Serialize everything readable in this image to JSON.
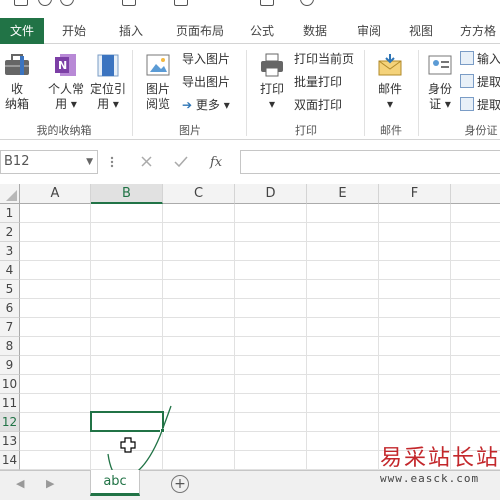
{
  "tabs": [
    "文件",
    "开始",
    "插入",
    "页面布局",
    "公式",
    "数据",
    "审阅",
    "视图",
    "方方格"
  ],
  "ribbon": {
    "shoujian": {
      "line1": "收",
      "line2": "纳箱"
    },
    "personal": {
      "line1": "个人常",
      "line2": "用 ▾"
    },
    "locate": {
      "line1": "定位引",
      "line2": "用 ▾"
    },
    "group1_label": "我的收纳箱",
    "img_browse": {
      "line1": "图片",
      "line2": "阅览"
    },
    "import_img": "导入图片",
    "export_img": "导出图片",
    "more": "更多 ▾",
    "group2_label": "图片",
    "print": {
      "line1": "打印",
      "line2": "▾"
    },
    "print_current": "打印当前页",
    "batch_print": "批量打印",
    "duplex_print": "双面打印",
    "group3_label": "打印",
    "mail": {
      "line1": "邮件",
      "line2": "▾"
    },
    "group4_label": "邮件",
    "idcard": {
      "line1": "身份",
      "line2": "证 ▾"
    },
    "input_id": "输入身",
    "extract_gender": "提取性",
    "extract_birth": "提取出",
    "group5_label": "身份证"
  },
  "formula_bar": {
    "name_box": "B12",
    "value": ""
  },
  "columns": [
    "A",
    "B",
    "C",
    "D",
    "E",
    "F"
  ],
  "rows": [
    "1",
    "2",
    "3",
    "4",
    "5",
    "6",
    "7",
    "8",
    "9",
    "10",
    "11",
    "12",
    "13",
    "14"
  ],
  "selected": {
    "col": "B",
    "row": "12"
  },
  "sheet_tab": "abc",
  "watermark": {
    "cn": "易采站长站",
    "url": "www.easck.com"
  },
  "colors": {
    "accent": "#217346",
    "watermark_red": "#c3272b"
  }
}
